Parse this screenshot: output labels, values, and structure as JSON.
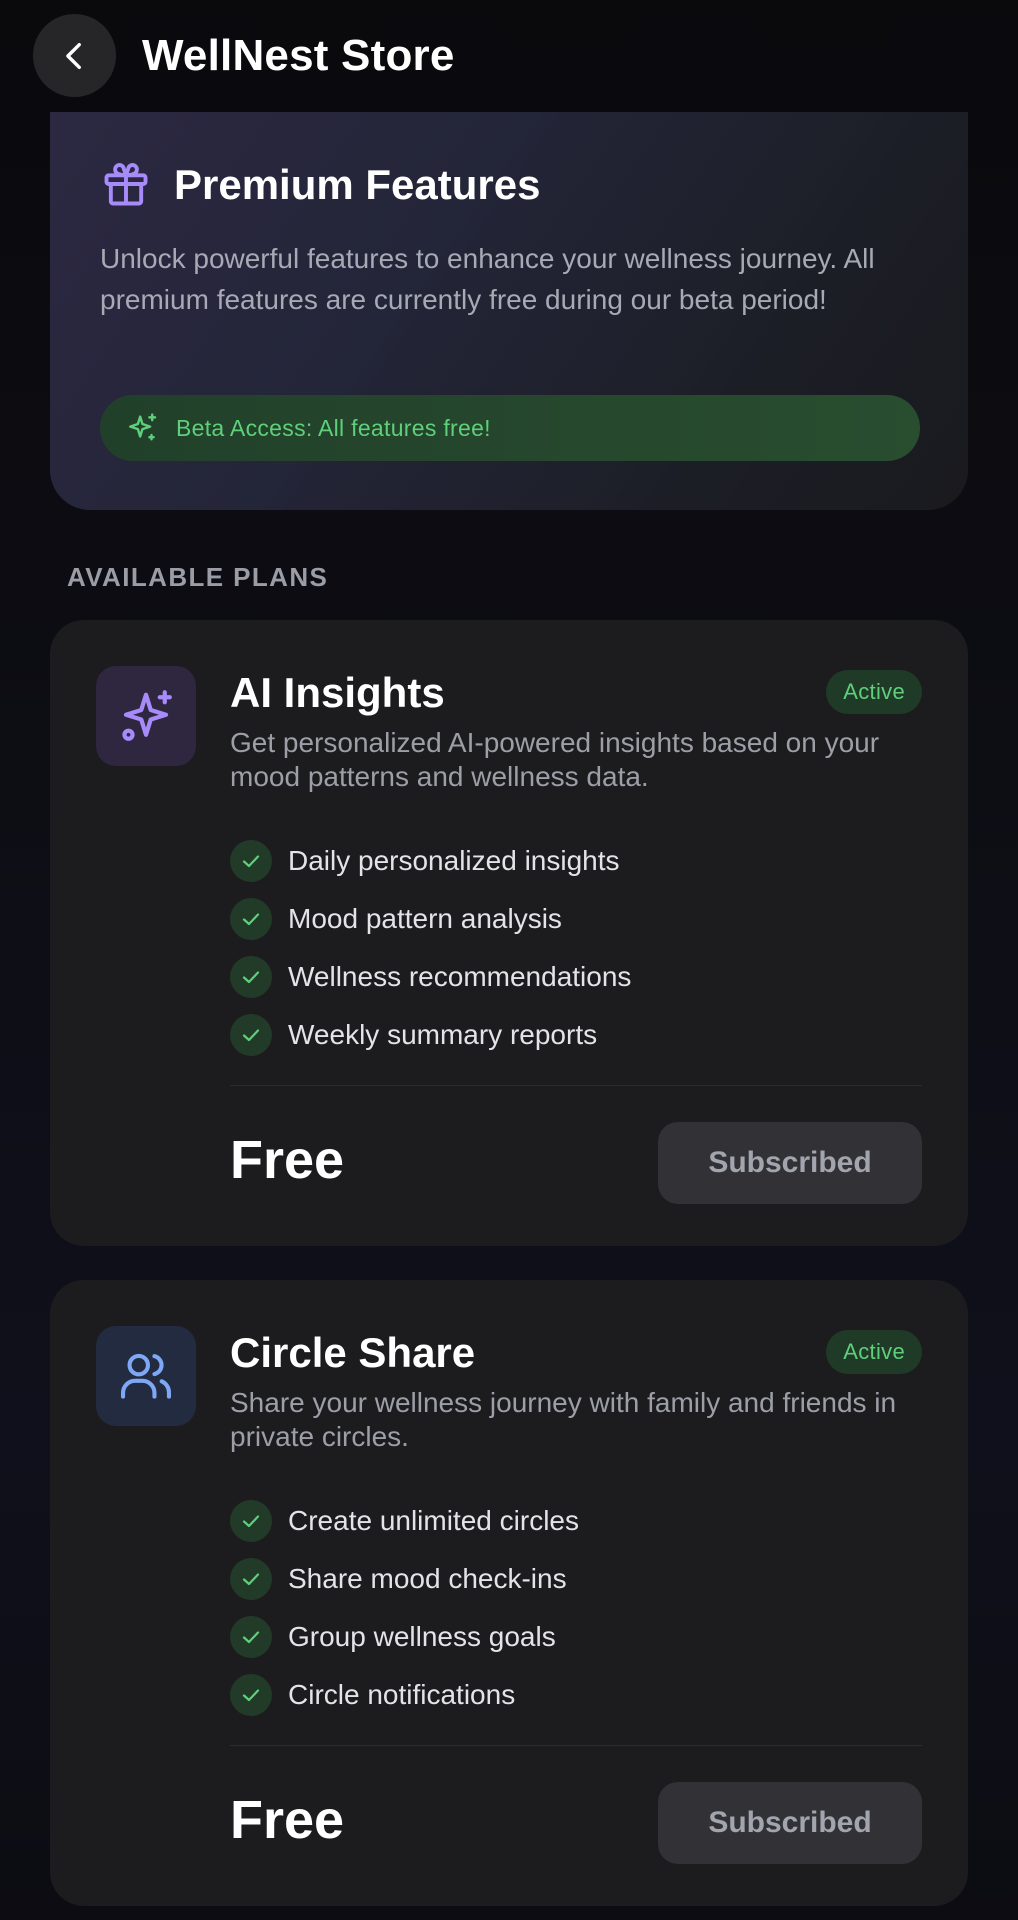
{
  "header": {
    "title": "WellNest Store",
    "back_icon": "chevron-left-icon"
  },
  "hero": {
    "icon": "gift-icon",
    "title": "Premium Features",
    "description": "Unlock powerful features to enhance your wellness journey. All premium features are currently free during our beta period!",
    "beta_icon": "sparkles-icon",
    "beta_text": "Beta Access: All features free!"
  },
  "section_label": "AVAILABLE PLANS",
  "plans": [
    {
      "icon": "sparkles-icon",
      "title": "AI Insights",
      "status": "Active",
      "description": "Get personalized AI-powered insights based on your mood patterns and wellness data.",
      "features": [
        "Daily personalized insights",
        "Mood pattern analysis",
        "Wellness recommendations",
        "Weekly summary reports"
      ],
      "price": "Free",
      "button_label": "Subscribed"
    },
    {
      "icon": "users-icon",
      "title": "Circle Share",
      "status": "Active",
      "description": "Share your wellness journey with family and friends in private circles.",
      "features": [
        "Create unlimited circles",
        "Share mood check-ins",
        "Group wellness goals",
        "Circle notifications"
      ],
      "price": "Free",
      "button_label": "Subscribed"
    }
  ],
  "colors": {
    "accent_green": "#5fd07a",
    "accent_purple": "#a78bfa",
    "accent_blue": "#7ea7f5",
    "card_bg": "#1c1c1e"
  }
}
